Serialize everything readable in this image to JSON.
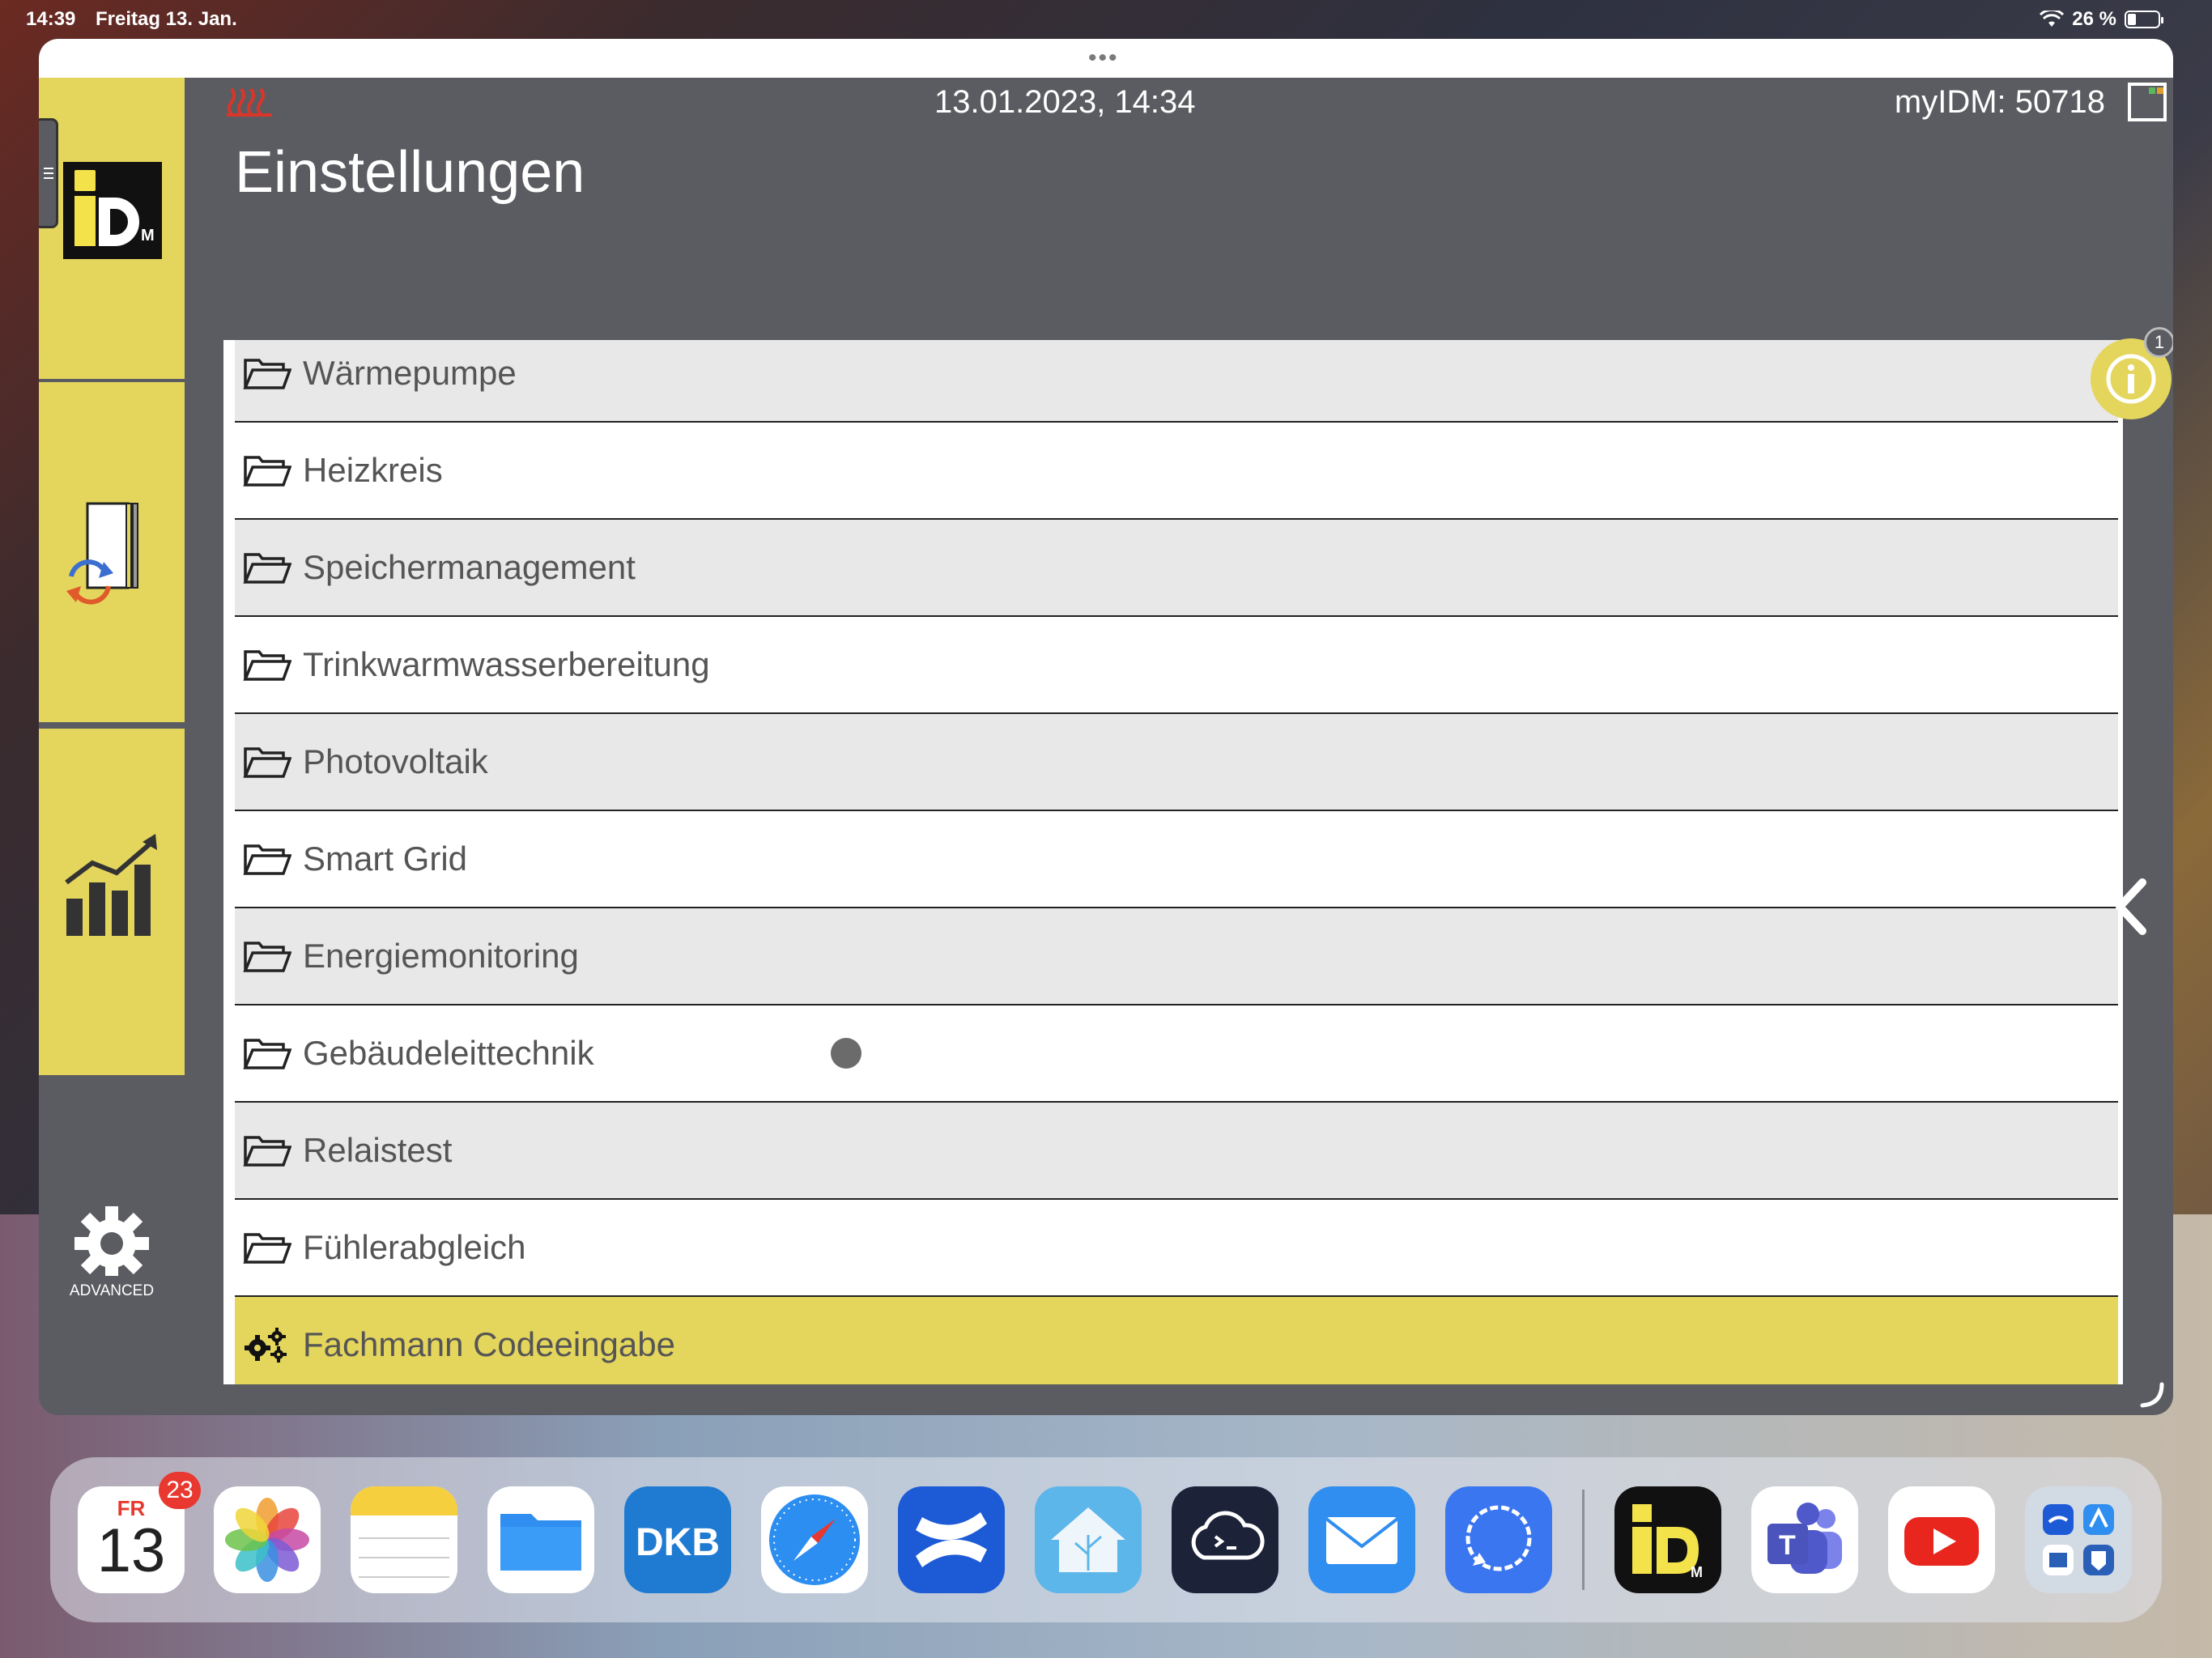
{
  "status_bar": {
    "time": "14:39",
    "date": "Freitag 13. Jan.",
    "battery": "26 %"
  },
  "header": {
    "datetime": "13.01.2023, 14:34",
    "device": "myIDM: 50718",
    "title": "Einstellungen"
  },
  "sidebar": {
    "advanced_label": "ADVANCED"
  },
  "menu": {
    "items": [
      {
        "label": "Wärmepumpe"
      },
      {
        "label": "Heizkreis"
      },
      {
        "label": "Speichermanagement"
      },
      {
        "label": "Trinkwarmwasserbereitung"
      },
      {
        "label": "Photovoltaik"
      },
      {
        "label": "Smart Grid"
      },
      {
        "label": "Energiemonitoring"
      },
      {
        "label": "Gebäudeleittechnik"
      },
      {
        "label": "Relaistest"
      },
      {
        "label": "Fühlerabgleich"
      },
      {
        "label": "Fachmann Codeeingabe"
      }
    ]
  },
  "info": {
    "count": "1"
  },
  "dock": {
    "calendar_day": "FR",
    "calendar_date": "13",
    "calendar_badge": "23",
    "dkb_label": "DKB",
    "apps": [
      "Kalender",
      "Fotos",
      "Notizen",
      "Dateien",
      "DKB",
      "Safari",
      "Confluence",
      "Home Assistant",
      "Prompt",
      "Mail",
      "Signal",
      "myiDM",
      "Teams",
      "YouTube",
      "App-Bibliothek"
    ]
  },
  "colors": {
    "accent_yellow": "#e4d55d",
    "panel_gray": "#5b5c61",
    "row_alt": "#e8e8e8"
  }
}
